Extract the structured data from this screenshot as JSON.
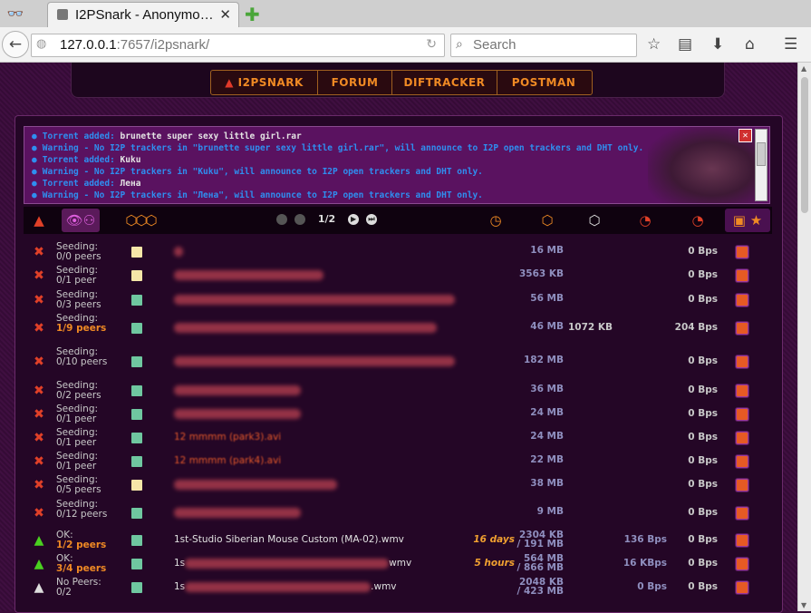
{
  "browser": {
    "tab_title": "I2PSnark - Anonymo…",
    "tab_close": "✕",
    "new_tab": "✚",
    "url_host": "127.0.0.1",
    "url_rest": ":7657/i2psnark/",
    "search_placeholder": "Search"
  },
  "topnav": [
    "I2PSNARK",
    "FORUM",
    "DIFTRACKER",
    "POSTMAN"
  ],
  "messages": [
    {
      "prefix": "Torrent added: ",
      "name": "brunette super sexy little girl.rar",
      "suffix": ""
    },
    {
      "prefix": "Warning - No I2P trackers in \"brunette super sexy little girl.rar\", will announce to I2P open trackers and DHT only.",
      "name": "",
      "suffix": ""
    },
    {
      "prefix": "Torrent added: ",
      "name": "Kuku",
      "suffix": ""
    },
    {
      "prefix": "Warning - No I2P trackers in \"Kuku\", will announce to I2P open trackers and DHT only.",
      "name": "",
      "suffix": ""
    },
    {
      "prefix": "Torrent added: ",
      "name": "Лена",
      "suffix": ""
    },
    {
      "prefix": "Warning - No I2P trackers in \"Лена\", will announce to I2P open trackers and DHT only.",
      "name": "",
      "suffix": ""
    }
  ],
  "pager": {
    "label": "1/2"
  },
  "colors": {
    "accent": "#f08a24",
    "status_seed": "#c8c8c8",
    "size": "#8f8fbf",
    "stop": "#e65a24"
  },
  "torrents": [
    {
      "status": "Seeding:",
      "peers": "0/0 peers",
      "hl": false,
      "ftype": "folder",
      "name": "",
      "blur": 10,
      "eta": "",
      "size": "16 MB",
      "size2": "",
      "down": "",
      "dlrate": "",
      "uprate": "0 Bps"
    },
    {
      "status": "Seeding:",
      "peers": "0/1 peer",
      "hl": false,
      "ftype": "folder",
      "name": "",
      "blur": 165,
      "eta": "",
      "size": "3563 KB",
      "size2": "",
      "down": "",
      "dlrate": "",
      "uprate": "0 Bps"
    },
    {
      "status": "Seeding:",
      "peers": "0/3 peers",
      "hl": false,
      "ftype": "file",
      "name": "",
      "blur": 310,
      "eta": "",
      "size": "56 MB",
      "size2": "",
      "down": "",
      "dlrate": "",
      "uprate": "0 Bps"
    },
    {
      "status": "Seeding:",
      "peers": "1/9 peers",
      "hl": true,
      "ftype": "file",
      "name": "",
      "blur": 290,
      "eta": "",
      "size": "46 MB",
      "size2": "",
      "down": "1072 KB",
      "dlrate": "",
      "uprate": "204 Bps"
    },
    {
      "status": "Seeding:",
      "peers": "0/10 peers",
      "hl": false,
      "ftype": "file",
      "name": "",
      "blur": 310,
      "eta": "",
      "size": "182 MB",
      "size2": "",
      "down": "",
      "dlrate": "",
      "uprate": "0 Bps"
    },
    {
      "status": "Seeding:",
      "peers": "0/2 peers",
      "hl": false,
      "ftype": "file",
      "name": "",
      "blur": 140,
      "eta": "",
      "size": "36 MB",
      "size2": "",
      "down": "",
      "dlrate": "",
      "uprate": "0 Bps"
    },
    {
      "status": "Seeding:",
      "peers": "0/1 peer",
      "hl": false,
      "ftype": "file",
      "name": "",
      "blur": 140,
      "eta": "",
      "size": "24 MB",
      "size2": "",
      "down": "",
      "dlrate": "",
      "uprate": "0 Bps"
    },
    {
      "status": "Seeding:",
      "peers": "0/1 peer",
      "hl": false,
      "ftype": "file",
      "name": "12 mmmm (park3).avi",
      "blur": 0,
      "eta": "",
      "size": "24 MB",
      "size2": "",
      "down": "",
      "dlrate": "",
      "uprate": "0 Bps"
    },
    {
      "status": "Seeding:",
      "peers": "0/1 peer",
      "hl": false,
      "ftype": "file",
      "name": "12 mmmm (park4).avi",
      "blur": 0,
      "eta": "",
      "size": "22 MB",
      "size2": "",
      "down": "",
      "dlrate": "",
      "uprate": "0 Bps"
    },
    {
      "status": "Seeding:",
      "peers": "0/5 peers",
      "hl": false,
      "ftype": "folder",
      "name": "",
      "blur": 180,
      "eta": "",
      "size": "38 MB",
      "size2": "",
      "down": "",
      "dlrate": "",
      "uprate": "0 Bps"
    },
    {
      "status": "Seeding:",
      "peers": "0/12 peers",
      "hl": false,
      "ftype": "file",
      "name": "",
      "blur": 140,
      "eta": "",
      "size": "9 MB",
      "size2": "",
      "down": "",
      "dlrate": "",
      "uprate": "0 Bps"
    },
    {
      "status": "OK:",
      "peers": "1/2 peers",
      "hl": true,
      "ftype": "file",
      "name": "1st-Studio Siberian Mouse Custom (MA-02).wmv",
      "blur": 0,
      "eta": "16 days",
      "size": "2304 KB",
      "size2": "/ 191 MB",
      "down": "",
      "dlrate": "136 Bps",
      "uprate": "0 Bps"
    },
    {
      "status": "OK:",
      "peers": "3/4 peers",
      "hl": true,
      "ftype": "file",
      "name": "1s",
      "blur": 225,
      "name_tail": "wmv",
      "eta": "5 hours",
      "size": "564 MB",
      "size2": "/ 866 MB",
      "down": "",
      "dlrate": "16 KBps",
      "uprate": "0 Bps"
    },
    {
      "status": "No Peers:",
      "peers": "0/2",
      "hl": false,
      "ftype": "file",
      "name": "1s",
      "blur": 205,
      "name_tail": ".wmv",
      "eta": "",
      "size": "2048 KB",
      "size2": "/ 423 MB",
      "down": "",
      "dlrate": "0 Bps",
      "uprate": "0 Bps"
    }
  ]
}
